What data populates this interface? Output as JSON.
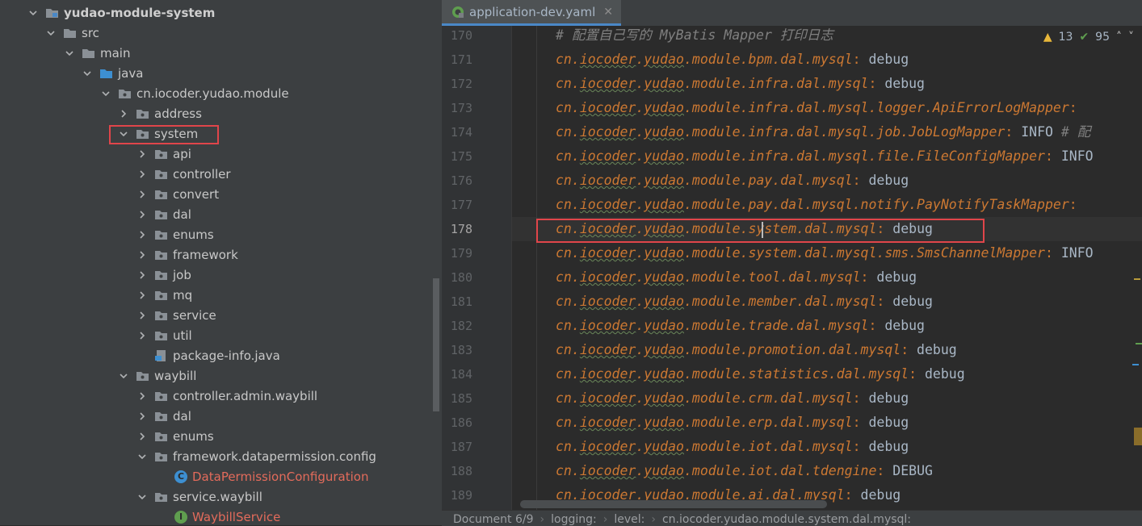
{
  "project_tree": {
    "root": "yudao-module-system",
    "nodes": [
      {
        "label": "src"
      },
      {
        "label": "main"
      },
      {
        "label": "java"
      },
      {
        "label": "cn.iocoder.yudao.module"
      },
      {
        "label": "address"
      },
      {
        "label": "system"
      },
      {
        "label": "api"
      },
      {
        "label": "controller"
      },
      {
        "label": "convert"
      },
      {
        "label": "dal"
      },
      {
        "label": "enums"
      },
      {
        "label": "framework"
      },
      {
        "label": "job"
      },
      {
        "label": "mq"
      },
      {
        "label": "service"
      },
      {
        "label": "util"
      },
      {
        "label": "package-info.java"
      },
      {
        "label": "waybill"
      },
      {
        "label": "controller.admin.waybill"
      },
      {
        "label": "dal"
      },
      {
        "label": "enums"
      },
      {
        "label": "framework.datapermission.config"
      },
      {
        "label": "DataPermissionConfiguration"
      },
      {
        "label": "service.waybill"
      },
      {
        "label": "WaybillService"
      }
    ]
  },
  "editor": {
    "tab_label": "application-dev.yaml",
    "inspections": {
      "warnings": "13",
      "ok": "95"
    },
    "lines": [
      {
        "num": "170",
        "text": "# 配置自己写的 MyBatis Mapper 打印日志"
      },
      {
        "num": "171",
        "key": "cn.iocoder.yudao.module.bpm.dal.mysql",
        "val": " debug"
      },
      {
        "num": "172",
        "key": "cn.iocoder.yudao.module.infra.dal.mysql",
        "val": " debug"
      },
      {
        "num": "173",
        "key": "cn.iocoder.yudao.module.infra.dal.mysql.logger.ApiErrorLogMapper",
        "val": ""
      },
      {
        "num": "174",
        "key": "cn.iocoder.yudao.module.infra.dal.mysql.job.JobLogMapper",
        "val": " INFO",
        "comment": " # 配"
      },
      {
        "num": "175",
        "key": "cn.iocoder.yudao.module.infra.dal.mysql.file.FileConfigMapper",
        "val": " INFO"
      },
      {
        "num": "176",
        "key": "cn.iocoder.yudao.module.pay.dal.mysql",
        "val": " debug"
      },
      {
        "num": "177",
        "key": "cn.iocoder.yudao.module.pay.dal.mysql.notify.PayNotifyTaskMapper",
        "val": ""
      },
      {
        "num": "178",
        "key": "cn.iocoder.yudao.module.system.dal.mysql",
        "val": " debug"
      },
      {
        "num": "179",
        "key": "cn.iocoder.yudao.module.system.dal.mysql.sms.SmsChannelMapper",
        "val": " INFO"
      },
      {
        "num": "180",
        "key": "cn.iocoder.yudao.module.tool.dal.mysql",
        "val": " debug"
      },
      {
        "num": "181",
        "key": "cn.iocoder.yudao.module.member.dal.mysql",
        "val": " debug"
      },
      {
        "num": "182",
        "key": "cn.iocoder.yudao.module.trade.dal.mysql",
        "val": " debug"
      },
      {
        "num": "183",
        "key": "cn.iocoder.yudao.module.promotion.dal.mysql",
        "val": " debug"
      },
      {
        "num": "184",
        "key": "cn.iocoder.yudao.module.statistics.dal.mysql",
        "val": " debug"
      },
      {
        "num": "185",
        "key": "cn.iocoder.yudao.module.crm.dal.mysql",
        "val": " debug"
      },
      {
        "num": "186",
        "key": "cn.iocoder.yudao.module.erp.dal.mysql",
        "val": " debug"
      },
      {
        "num": "187",
        "key": "cn.iocoder.yudao.module.iot.dal.mysql",
        "val": " debug"
      },
      {
        "num": "188",
        "key": "cn.iocoder.yudao.module.iot.dal.tdengine",
        "val": " DEBUG"
      },
      {
        "num": "189",
        "key": "cn.iocoder.yudao.module.ai.dal.mysql",
        "val": " debug"
      }
    ]
  },
  "breadcrumb": {
    "items": [
      "Document 6/9",
      "logging:",
      "level:",
      "cn.iocoder.yudao.module.system.dal.mysql:"
    ]
  },
  "colors": {
    "highlight": "#e0454a",
    "key": "#cc7832",
    "value": "#a9b7c6",
    "comment": "#629755"
  }
}
